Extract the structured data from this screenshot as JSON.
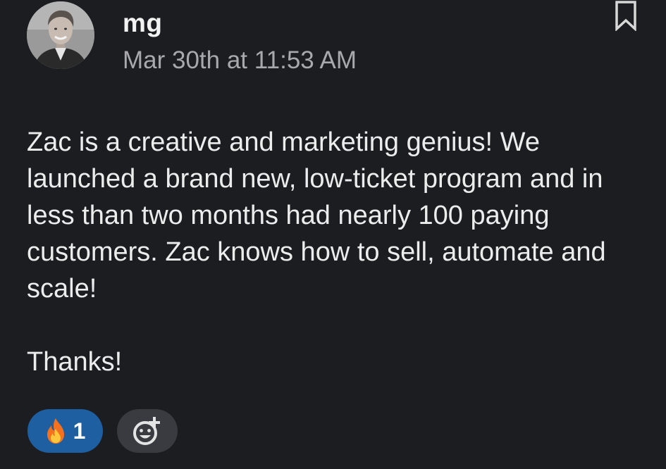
{
  "message": {
    "username": "mg",
    "timestamp": "Mar 30th at 11:53 AM",
    "paragraphs": [
      "Zac is a creative and marketing genius! We launched a brand new, low-ticket program and in less than two months had nearly 100 paying customers. Zac knows how to sell, automate and scale!"
    ],
    "closing": "Thanks!"
  },
  "reactions": [
    {
      "emoji": "fire-emoji",
      "count": "1",
      "selected": true,
      "color": "#1d5fa0"
    }
  ],
  "icons": {
    "bookmark": "bookmark-icon",
    "add_reaction": "add-reaction-icon"
  },
  "colors": {
    "background": "#1c1d21",
    "text": "#ececec",
    "muted": "#a9a9ad",
    "reaction_selected": "#1d5fa0",
    "reaction_neutral": "#3a3b40"
  }
}
